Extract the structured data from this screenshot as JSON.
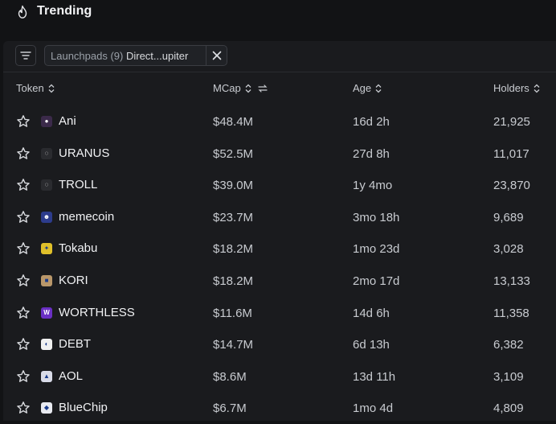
{
  "header": {
    "title": "Trending",
    "icon": "flame-icon"
  },
  "filters": {
    "chip_key": "Launchpads (9)",
    "chip_value": "Direct...upiter"
  },
  "columns": [
    {
      "label": "Token"
    },
    {
      "label": "MCap"
    },
    {
      "label": "Age"
    },
    {
      "label": "Holders"
    }
  ],
  "rows": [
    {
      "name": "Ani",
      "logo_color": "#3b2a4a",
      "logo_glyph": "●",
      "mcap": "$48.4M",
      "age": "16d 2h",
      "holders": "21,925"
    },
    {
      "name": "URANUS",
      "logo_color": "#2a2b2f",
      "logo_glyph": "◌",
      "mcap": "$52.5M",
      "age": "27d 8h",
      "holders": "11,017"
    },
    {
      "name": "TROLL",
      "logo_color": "#2a2b2f",
      "logo_glyph": "◌",
      "mcap": "$39.0M",
      "age": "1y 4mo",
      "holders": "23,870"
    },
    {
      "name": "memecoin",
      "logo_color": "#2d3c8c",
      "logo_glyph": "☻",
      "mcap": "$23.7M",
      "age": "3mo 18h",
      "holders": "9,689"
    },
    {
      "name": "Tokabu",
      "logo_color": "#e0c02a",
      "logo_glyph": "✦",
      "mcap": "$18.2M",
      "age": "1mo 23d",
      "holders": "3,028"
    },
    {
      "name": "KORI",
      "logo_color": "#b9976a",
      "logo_glyph": "■",
      "mcap": "$18.2M",
      "age": "2mo 17d",
      "holders": "13,133"
    },
    {
      "name": "WORTHLESS",
      "logo_color": "#6a2fc4",
      "logo_glyph": "W",
      "mcap": "$11.6M",
      "age": "14d 6h",
      "holders": "11,358"
    },
    {
      "name": "DEBT",
      "logo_color": "#f0f0f0",
      "logo_glyph": "◐",
      "mcap": "$14.7M",
      "age": "6d 13h",
      "holders": "6,382"
    },
    {
      "name": "AOL",
      "logo_color": "#d9dbe8",
      "logo_glyph": "▲",
      "mcap": "$8.6M",
      "age": "13d 11h",
      "holders": "3,109"
    },
    {
      "name": "BlueChip",
      "logo_color": "#e8eaf0",
      "logo_glyph": "◆",
      "mcap": "$6.7M",
      "age": "1mo 4d",
      "holders": "4,809"
    }
  ]
}
